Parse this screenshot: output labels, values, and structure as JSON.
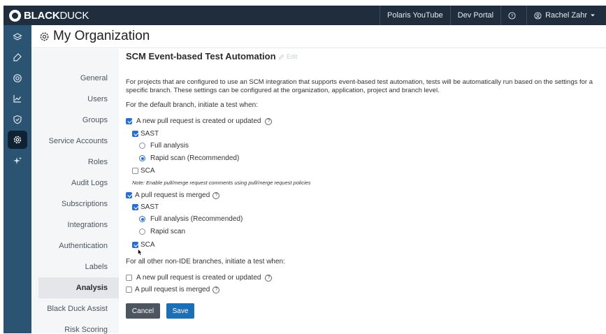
{
  "brand": {
    "bold": "BLACK",
    "light": "DUCK"
  },
  "topnav": [
    {
      "label": "Polaris YouTube",
      "icon": ""
    },
    {
      "label": "Dev Portal",
      "icon": ""
    },
    {
      "label": "",
      "icon": "help-icon"
    },
    {
      "label": "Rachel Zahr",
      "icon": "user-icon"
    }
  ],
  "rail_icons": [
    "layers-icon",
    "tag-icon",
    "target-icon",
    "chart-icon",
    "shield-icon",
    "settings-icon",
    "sparkle-icon"
  ],
  "page": {
    "title": "My Organization"
  },
  "sidenav": {
    "items": [
      "General",
      "Users",
      "Groups",
      "Service Accounts",
      "Roles",
      "Audit Logs",
      "Subscriptions",
      "Integrations",
      "Authentication",
      "Labels",
      "Analysis",
      "Black Duck Assist",
      "Risk Scoring"
    ],
    "active": "Analysis"
  },
  "section": {
    "title": "SCM Event-based Test Automation",
    "edit_label": "Edit",
    "description": "For projects that are configured to use an SCM integration that supports event-based test automation, tests will be automatically run based on the settings for a specific branch. These settings can be configured at the organization, application, project and branch level.",
    "default_heading": "For the default branch, initiate a test when:",
    "pr_created": "A new pull request is created or updated",
    "sast": "SAST",
    "full_analysis": "Full analysis",
    "rapid_rec": "Rapid scan (Recommended)",
    "sca": "SCA",
    "note": "Note: Enable pull/merge request comments using pull/merge request policies",
    "pr_merged": "A pull request is merged",
    "full_rec": "Full analysis (Recommended)",
    "rapid": "Rapid scan",
    "other_heading": "For all other non-IDE branches, initiate a test when:",
    "other_pr_created": "A new pull request is created or updated",
    "other_pr_merged": "A pull request is merged",
    "help_glyph": "?"
  },
  "buttons": {
    "cancel": "Cancel",
    "save": "Save"
  },
  "colors": {
    "topbar": "#1f2d3d",
    "rail": "#2b5473",
    "accent": "#2a6fcf",
    "save": "#1d6fb5",
    "cancel": "#4d5560"
  }
}
